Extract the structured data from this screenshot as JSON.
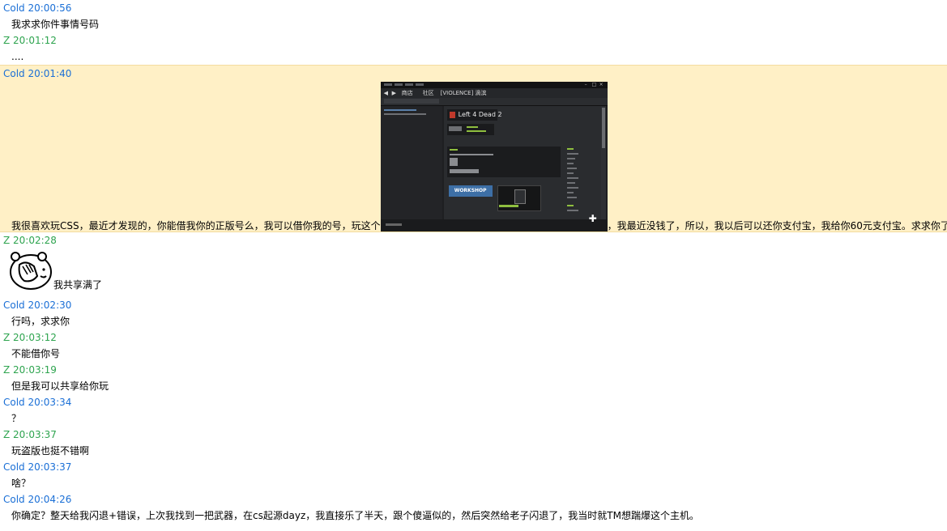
{
  "colors": {
    "cold": "#1a6fd6",
    "z": "#2ea44f",
    "highlight": "#fff0c6"
  },
  "messages": [
    {
      "sender": "Cold",
      "header": "Cold 20:00:56",
      "text": "我求求你件事情号码"
    },
    {
      "sender": "Z",
      "header": "Z 20:01:12",
      "text": "...."
    },
    {
      "sender": "Cold",
      "header": "Cold 20:01:40",
      "text_before": "我很喜欢玩CSS，最近才发现的，你能借我你的正版号么，我可以借你我的号，玩这个",
      "text_after": "，我最近没钱了，所以，我以后可以还你支付宝，我给你60元支付宝。求求你了",
      "embedded_screenshot": {
        "nav_tabs": [
          "商店",
          "社区",
          "[VIOLENCE] 滴滨"
        ],
        "game_title": "Left 4 Dead 2",
        "workshop_label": "WORKSHOP"
      }
    },
    {
      "sender": "Z",
      "header": "Z 20:02:28",
      "icon": "facepalm-face-icon",
      "text": "我共享满了"
    },
    {
      "sender": "Cold",
      "header": "Cold 20:02:30",
      "text": "行吗，求求你"
    },
    {
      "sender": "Z",
      "header": "Z 20:03:12",
      "text": "不能借你号"
    },
    {
      "sender": "Z",
      "header": "Z 20:03:19",
      "text": "但是我可以共享给你玩"
    },
    {
      "sender": "Cold",
      "header": "Cold 20:03:34",
      "text": "？"
    },
    {
      "sender": "Z",
      "header": "Z 20:03:37",
      "text": "玩盗版也挺不错啊"
    },
    {
      "sender": "Cold",
      "header": "Cold 20:03:37",
      "text": "啥？"
    },
    {
      "sender": "Cold",
      "header": "Cold 20:04:26",
      "text": "你确定？整天给我闪退+错误，上次我找到一把武器，在cs起源dayz，我直接乐了半天，跟个傻逼似的，然后突然给老子闪退了，我当时就TM想踹爆这个主机。"
    }
  ]
}
